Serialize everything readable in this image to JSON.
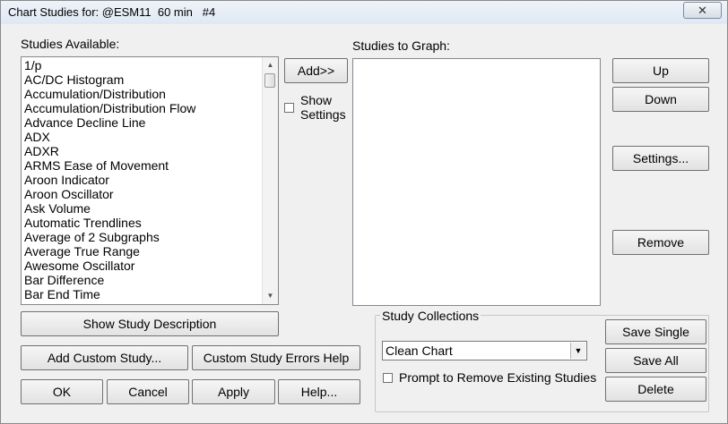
{
  "window": {
    "title": "Chart Studies for: @ESM11  60 min   #4",
    "close_glyph": "✕"
  },
  "studies_available": {
    "label": "Studies Available:",
    "items": [
      "1/p",
      "AC/DC Histogram",
      "Accumulation/Distribution",
      "Accumulation/Distribution Flow",
      "Advance Decline Line",
      "ADX",
      "ADXR",
      "ARMS Ease of Movement",
      "Aroon Indicator",
      "Aroon Oscillator",
      "Ask Volume",
      "Automatic Trendlines",
      "Average of 2 Subgraphs",
      "Average True Range",
      "Awesome Oscillator",
      "Bar Difference",
      "Bar End Time"
    ]
  },
  "studies_to_graph": {
    "label": "Studies to Graph:",
    "items": []
  },
  "buttons": {
    "add": "Add>>",
    "up": "Up",
    "down": "Down",
    "settings": "Settings...",
    "remove": "Remove",
    "show_study_description": "Show Study Description",
    "add_custom_study": "Add Custom Study...",
    "custom_study_errors_help": "Custom Study Errors Help",
    "ok": "OK",
    "cancel": "Cancel",
    "apply": "Apply",
    "help": "Help...",
    "save_single": "Save Single",
    "save_all": "Save All",
    "delete": "Delete"
  },
  "show_settings": {
    "line1": "Show",
    "line2": "Settings",
    "checked": false
  },
  "study_collections": {
    "label": "Study Collections",
    "selected": "Clean Chart",
    "prompt_label": "Prompt to Remove Existing Studies",
    "prompt_checked": false
  }
}
